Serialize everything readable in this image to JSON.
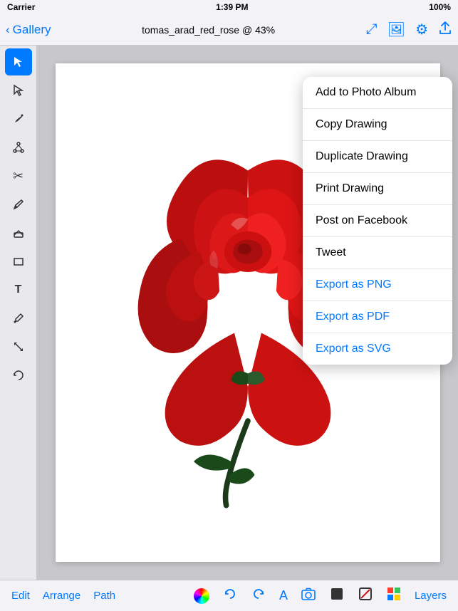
{
  "status_bar": {
    "carrier": "Carrier",
    "wifi_icon": "wifi",
    "time": "1:39 PM",
    "battery": "100%"
  },
  "nav_bar": {
    "back_label": "Gallery",
    "title": "tomas_arad_red_rose @ 43%"
  },
  "nav_icons": {
    "expand": "⤢",
    "image": "🖼",
    "gear": "⚙",
    "share": "↑"
  },
  "tools": [
    {
      "id": "select",
      "icon": "↖",
      "active": true
    },
    {
      "id": "subselect",
      "icon": "↗"
    },
    {
      "id": "pen",
      "icon": "✒"
    },
    {
      "id": "node",
      "icon": "✳"
    },
    {
      "id": "scissors",
      "icon": "✂"
    },
    {
      "id": "pencil",
      "icon": "✏"
    },
    {
      "id": "eraser",
      "icon": "⌫"
    },
    {
      "id": "rect",
      "icon": "▭"
    },
    {
      "id": "text",
      "icon": "T"
    },
    {
      "id": "eyedropper",
      "icon": "🔬"
    },
    {
      "id": "scale",
      "icon": "⤢"
    },
    {
      "id": "rotate",
      "icon": "↺"
    }
  ],
  "dropdown_menu": {
    "items": [
      {
        "id": "add-to-photo-album",
        "label": "Add to Photo Album",
        "color": "normal"
      },
      {
        "id": "copy-drawing",
        "label": "Copy Drawing",
        "color": "normal"
      },
      {
        "id": "duplicate-drawing",
        "label": "Duplicate Drawing",
        "color": "normal"
      },
      {
        "id": "print-drawing",
        "label": "Print Drawing",
        "color": "normal"
      },
      {
        "id": "post-on-facebook",
        "label": "Post on Facebook",
        "color": "normal"
      },
      {
        "id": "tweet",
        "label": "Tweet",
        "color": "normal"
      },
      {
        "id": "export-png",
        "label": "Export as PNG",
        "color": "blue"
      },
      {
        "id": "export-pdf",
        "label": "Export as PDF",
        "color": "blue"
      },
      {
        "id": "export-svg",
        "label": "Export as SVG",
        "color": "blue"
      }
    ]
  },
  "bottom_toolbar": {
    "edit_label": "Edit",
    "arrange_label": "Arrange",
    "path_label": "Path",
    "layers_label": "Layers"
  }
}
